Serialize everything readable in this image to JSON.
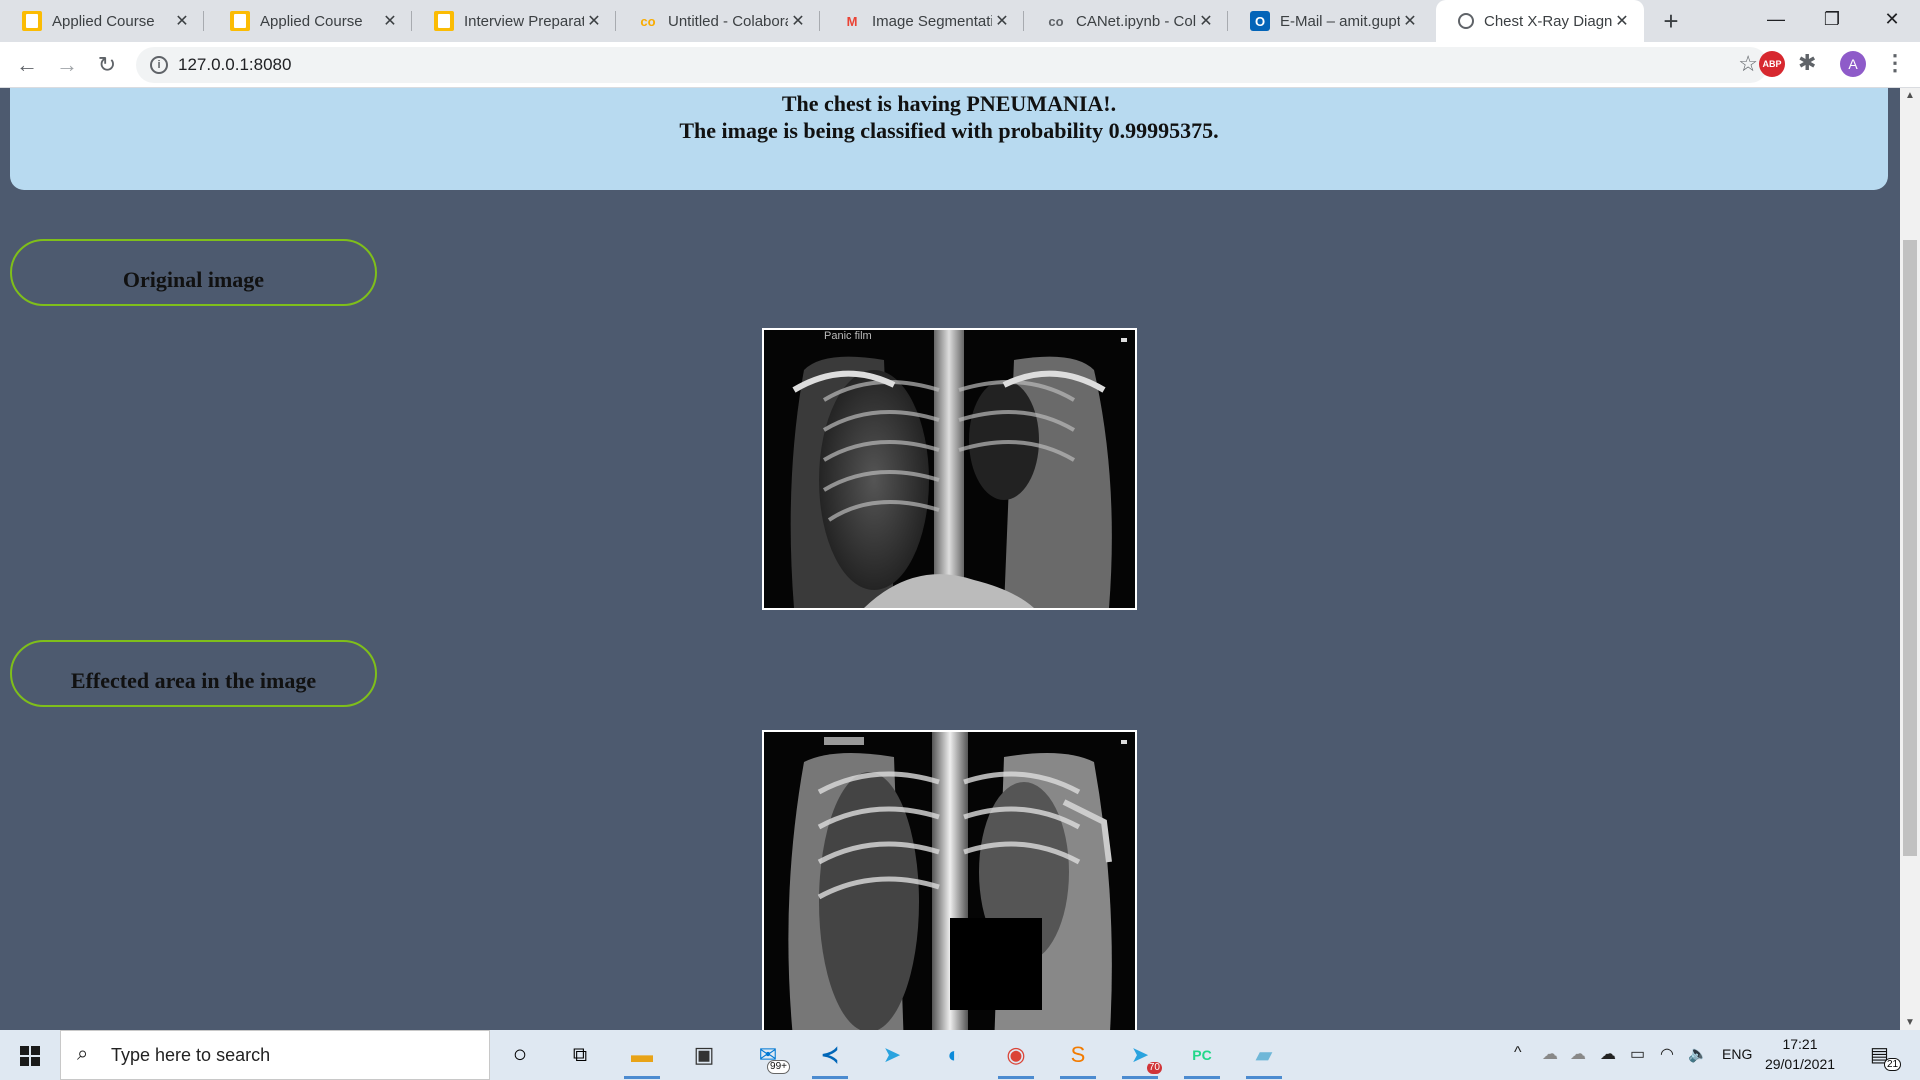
{
  "browser": {
    "tabs": [
      {
        "title": "Applied Course",
        "icon": "applied-course-icon"
      },
      {
        "title": "Applied Course",
        "icon": "applied-course-icon"
      },
      {
        "title": "Interview Preparati",
        "icon": "applied-course-icon"
      },
      {
        "title": "Untitled - Colabora",
        "icon": "colab-icon"
      },
      {
        "title": "Image Segmentati",
        "icon": "gmail-icon"
      },
      {
        "title": "CANet.ipynb - Cola",
        "icon": "colab-icon"
      },
      {
        "title": "E-Mail – amit.gupt",
        "icon": "outlook-icon"
      },
      {
        "title": "Chest X-Ray Diagn",
        "icon": "globe-icon",
        "active": true
      }
    ],
    "url": "127.0.0.1:8080",
    "profile_initial": "A",
    "abp_label": "ABP"
  },
  "page": {
    "result_line1": "The chest is having PNEUMANIA!.",
    "result_line2": "The image is being classified with probability 0.99995375.",
    "original_label": "Original image",
    "effected_label": "Effected area in the image",
    "original_overlay_text": "Panic film"
  },
  "taskbar": {
    "search_placeholder": "Type here to search",
    "mail_badge": "99+",
    "telegram_badge": "70",
    "language": "ENG",
    "time": "17:21",
    "date": "29/01/2021",
    "notification_count": "21"
  },
  "colors": {
    "page_background": "#4d5a6f",
    "result_box": "#b8daf0",
    "label_border": "#7fbf1a"
  }
}
